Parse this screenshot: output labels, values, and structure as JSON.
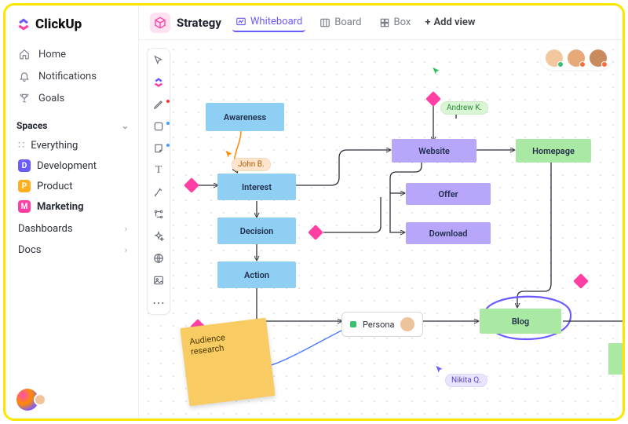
{
  "brand": {
    "name": "ClickUp"
  },
  "nav": {
    "home": "Home",
    "notifications": "Notifications",
    "goals": "Goals"
  },
  "spaces": {
    "header": "Spaces",
    "everything": "Everything",
    "items": [
      {
        "initial": "D",
        "label": "Development",
        "color": "#6a5bff"
      },
      {
        "initial": "P",
        "label": "Product",
        "color": "#ffb020"
      },
      {
        "initial": "M",
        "label": "Marketing",
        "color": "#ff3fa4"
      }
    ]
  },
  "sections": {
    "dashboards": "Dashboards",
    "docs": "Docs"
  },
  "topbar": {
    "space_title": "Strategy",
    "views": {
      "whiteboard": "Whiteboard",
      "board": "Board",
      "box": "Box"
    },
    "add_view": "Add view"
  },
  "nodes": {
    "awareness": "Awareness",
    "interest": "Interest",
    "decision": "Decision",
    "action": "Action",
    "website": "Website",
    "offer": "Offer",
    "download": "Download",
    "homepage": "Homepage",
    "blog": "Blog"
  },
  "persona": {
    "label": "Persona"
  },
  "sticky": {
    "text": "Audience research"
  },
  "cursors": {
    "john": "John B.",
    "andrew": "Andrew K.",
    "nikita": "Nikita Q."
  },
  "colors": {
    "accent_pink": "#ff3fa4",
    "accent_purple": "#6a5bff",
    "node_blue": "#8fcff4",
    "node_purple": "#b8a6fb",
    "node_green": "#a9e9a4",
    "sticky": "#f8cc63"
  }
}
